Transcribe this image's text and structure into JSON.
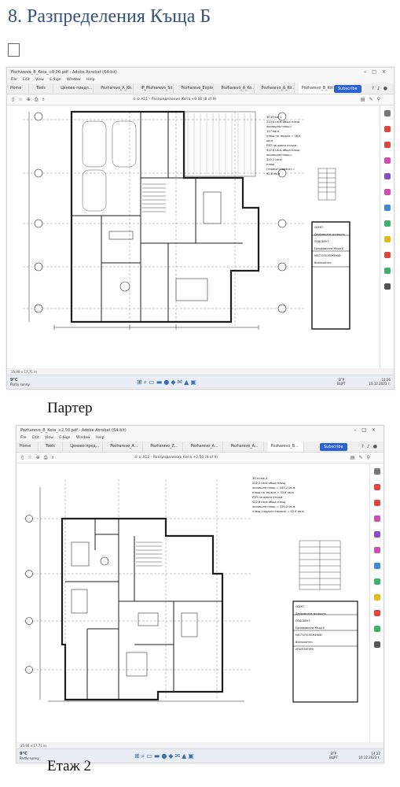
{
  "heading": "8. Разпределения Къща Б",
  "checkbox_glyph": "☐",
  "screens": [
    {
      "window_title": "Pozharevo_B_Kota_+0,00.pdf - Adobe Acrobat (64-bit)",
      "menu": [
        "File",
        "Edit",
        "View",
        "E-Sign",
        "Window",
        "Help"
      ],
      "tabs": [
        "Home",
        "Tools",
        "Ценово предл...",
        "Pozharevo_A_Ko...",
        "IP_Pozharevo_Sit...",
        "Pozharevo_Explo...",
        "Pozharevo_A_Ko...",
        "Pozharevo_A_Ko...",
        "Pozharevo_B_Kot..."
      ],
      "subscribe_label": "Subscribe",
      "page_label": "A11 - Разпределение Кота +0.00",
      "page_count": "(8 of 9)",
      "status_dims": "35,98 x 17,71 in",
      "weather_temp": "9°C",
      "weather_text": "Partly sunny",
      "lang": "БГР",
      "lang2": "ВЦРТ",
      "time": "14:26",
      "date": "10.12.2023 г.",
      "notes": [
        "ЗП етаж 1",
        "210,6 кв.м обща площ",
        "жилищна площ=",
        "157 кв.м",
        "площ на тераси = 58,8",
        "кв.м",
        "РЗП на двата етажа",
        "412,8 кв.м обща площ",
        "жилищна площ=",
        "320,2 кв.м",
        "площ",
        "(тераси+тераса) =",
        "92,6 кв.м"
      ],
      "titleblock": [
        "ОБЕКТ:",
        "Двуфамилна жилищна",
        "ПОДОБЕКТ:",
        "Еднофамилна Къща Б",
        "МЕСТОПОЛОЖЕНИЕ:",
        "Възложител:"
      ]
    },
    {
      "window_title": "Pozharevo_B_Kota_+2,50.pdf - Adobe Acrobat (64-bit)",
      "menu": [
        "File",
        "Edit",
        "View",
        "E-Sign",
        "Window",
        "Help"
      ],
      "tabs": [
        "Home",
        "Tools",
        "Ценово пред...",
        "Pozharevo_A...",
        "Pozharevo_Z...",
        "Pozharevo_A...",
        "Pozharevo_A...",
        "Pozharevo_B..."
      ],
      "subscribe_label": "Subscribe",
      "page_label": "A12 - Разпределение Кота +2.50",
      "page_count": "(9 of 9)",
      "status_dims": "35,98 x 17,71 in",
      "weather_temp": "9°C",
      "weather_text": "Partly sunny",
      "lang": "БГР",
      "lang2": "ВЦРТ",
      "time": "14:27",
      "date": "10.12.2023 г.",
      "notes": [
        "ЗП етаж 2",
        "202,2 кв.м обща площ",
        "жилищна площ = 163,2 кв.м",
        "площ на тераси = 33,8 кв.м",
        "РЗП на двата етажа",
        "412,8 кв.м обща площ",
        "жилищна площ = 320,2 кв.м",
        "площ (тераси+тераса) = 92,6 кв.м"
      ],
      "titleblock": [
        "ОБЕКТ:",
        "Двуфамилна жилищна",
        "ПОДОБЕКТ:",
        "Еднофамилна Къща Б",
        "МЕСТОПОЛОЖЕНИЕ:",
        "Възложител:",
        "АРХИТЕКТУРА"
      ]
    }
  ],
  "captions": [
    "Партер",
    "Етаж 2"
  ],
  "colors": {
    "heading": "#34527f",
    "subscribe": "#2a62d6",
    "plan_line": "#1e1e1e",
    "grid_dash": "#8a8a8a"
  },
  "icons": [
    "bookmark-icon",
    "star-icon",
    "print-icon",
    "search-icon",
    "zoom-icon",
    "close-icon",
    "user-icon",
    "bell-icon",
    "help-icon"
  ]
}
